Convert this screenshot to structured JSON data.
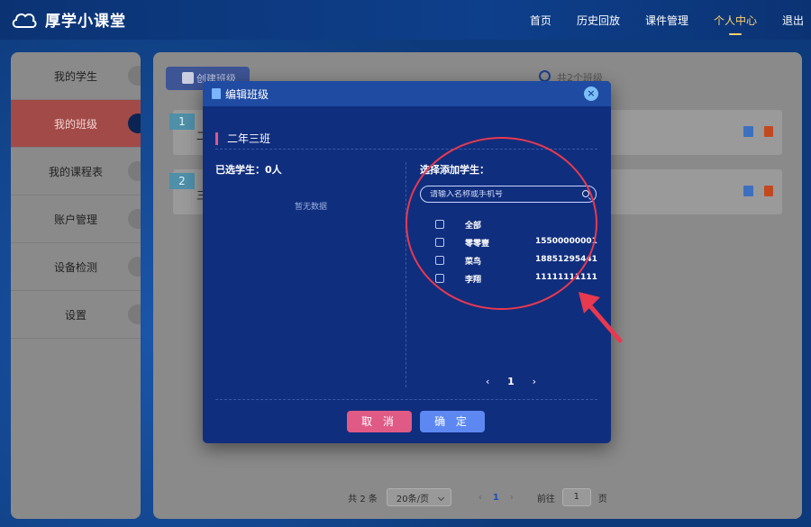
{
  "app": {
    "brand": "厚学小课堂"
  },
  "nav": [
    {
      "label": "首页"
    },
    {
      "label": "历史回放"
    },
    {
      "label": "课件管理"
    },
    {
      "label": "个人中心",
      "active": true
    },
    {
      "label": "退出"
    }
  ],
  "sidebar": {
    "items": [
      {
        "label": "我的学生"
      },
      {
        "label": "我的班级",
        "active": true
      },
      {
        "label": "我的课程表"
      },
      {
        "label": "账户管理"
      },
      {
        "label": "设备检测"
      },
      {
        "label": "设置"
      }
    ]
  },
  "main": {
    "create_label": "创建班级",
    "count_text": "共2个班级",
    "rows": [
      {
        "num": "1",
        "name": "二"
      },
      {
        "num": "2",
        "name": "三"
      }
    ],
    "pager": {
      "total": "共 2 条",
      "page_size": "20条/页",
      "prev": "‹",
      "current": "1",
      "next": "›",
      "goto_label": "前往",
      "goto_value": "1",
      "page_unit": "页"
    }
  },
  "modal": {
    "title": "编辑班级",
    "close": "×",
    "class_name": "二年三班",
    "selected_label": "已选学生：0人",
    "empty_text": "暂无数据",
    "add_label": "选择添加学生：",
    "search_placeholder": "请输入名称或手机号",
    "students": [
      {
        "name": "全部",
        "phone": ""
      },
      {
        "name": "零零壹",
        "phone": "15500000001"
      },
      {
        "name": "菜鸟",
        "phone": "18851295441"
      },
      {
        "name": "李翔",
        "phone": "11111111111"
      }
    ],
    "pager": {
      "prev": "‹",
      "current": "1",
      "next": "›"
    },
    "cancel_label": "取 消",
    "ok_label": "确 定"
  },
  "colors": {
    "accent_nav": "#ffd36a",
    "cancel": "#e05a86",
    "confirm": "#5d88f2",
    "annotation": "#e8394f"
  }
}
